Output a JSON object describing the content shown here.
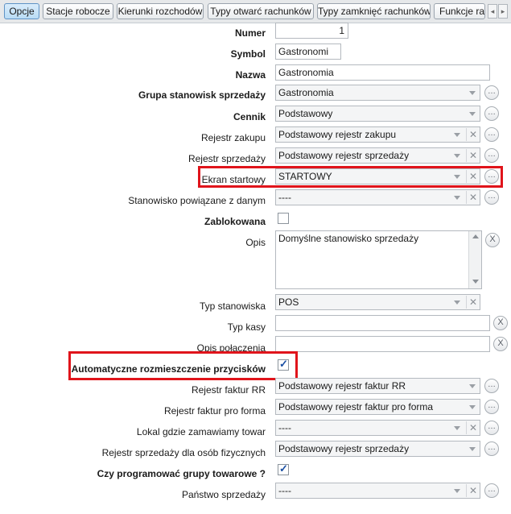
{
  "tabs": [
    {
      "label": "Opcje"
    },
    {
      "label": "Stacje robocze"
    },
    {
      "label": "Kierunki rozchodów"
    },
    {
      "label": "Typy otwarć rachunków"
    },
    {
      "label": "Typy zamknięć rachunków"
    },
    {
      "label": "Funkcje rac"
    }
  ],
  "form": {
    "numer": {
      "label": "Numer",
      "value": "1"
    },
    "symbol": {
      "label": "Symbol",
      "value": "Gastronomi"
    },
    "nazwa": {
      "label": "Nazwa",
      "value": "Gastronomia"
    },
    "grupa": {
      "label": "Grupa stanowisk sprzedaży",
      "value": "Gastronomia"
    },
    "cennik": {
      "label": "Cennik",
      "value": "Podstawowy"
    },
    "rejestr_zakupu": {
      "label": "Rejestr zakupu",
      "value": "Podstawowy rejestr zakupu"
    },
    "rejestr_sprzedazy": {
      "label": "Rejestr sprzedaży",
      "value": "Podstawowy rejestr sprzedaży"
    },
    "ekran_startowy": {
      "label": "Ekran startowy",
      "value": "STARTOWY"
    },
    "stanowisko_powiazane": {
      "label": "Stanowisko powiązane z danym",
      "value": "----"
    },
    "zablokowana": {
      "label": "Zablokowana",
      "checked": false
    },
    "opis": {
      "label": "Opis",
      "value": "Domyślne stanowisko sprzedaży"
    },
    "typ_stanowiska": {
      "label": "Typ stanowiska",
      "value": "POS"
    },
    "typ_kasy": {
      "label": "Typ kasy",
      "value": ""
    },
    "opis_polaczenia": {
      "label": "Opis połączenia",
      "value": ""
    },
    "auto_rozmieszczenie": {
      "label": "Automatyczne rozmieszczenie przycisków",
      "checked": true
    },
    "rejestr_rr": {
      "label": "Rejestr faktur RR",
      "value": "Podstawowy rejestr faktur RR"
    },
    "rejestr_pro_forma": {
      "label": "Rejestr faktur pro forma",
      "value": "Podstawowy rejestr faktur pro forma"
    },
    "lokal": {
      "label": "Lokal gdzie zamawiamy towar",
      "value": "----"
    },
    "rejestr_osob": {
      "label": "Rejestr sprzedaży dla osób fizycznych",
      "value": "Podstawowy rejestr sprzedaży"
    },
    "grupy_towarowe": {
      "label": "Czy programować grupy towarowe ?",
      "checked": true
    },
    "panstwo": {
      "label": "Państwo sprzedaży",
      "value": "----"
    }
  },
  "icons": {
    "ellipsis": "ellipsis-icon",
    "clear": "clear-x-icon",
    "dropdown": "dropdown-arrow-icon"
  },
  "colors": {
    "highlight": "#e0141b",
    "active_tab": "#b9dcf5"
  }
}
